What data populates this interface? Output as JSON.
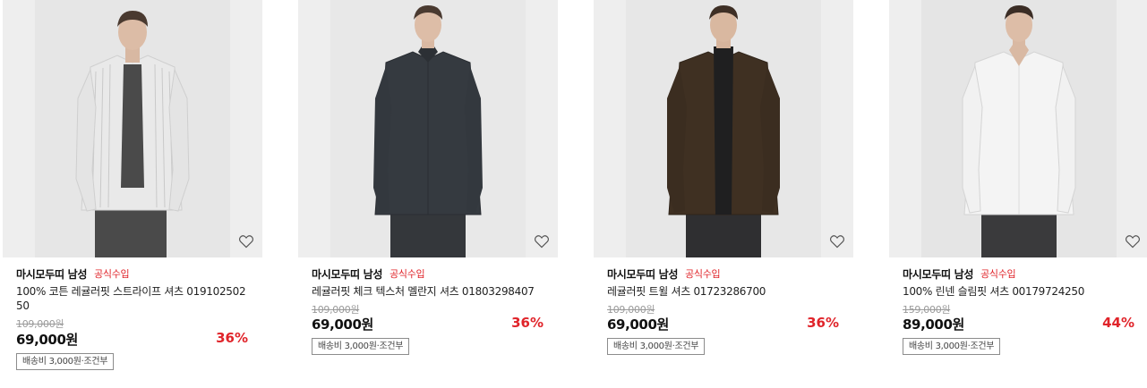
{
  "products": [
    {
      "brand": "마시모두띠 남성",
      "official_badge": "공식수입",
      "title": "100% 코튼 레귤러핏 스트라이프 셔츠 01910250250",
      "original_price": "109,000원",
      "price": "69,000원",
      "discount": "36%",
      "shipping": "배송비 3,000원·조건부",
      "wishlist_icon": "heart-outline-icon",
      "shirt_color": "#e9e9e9"
    },
    {
      "brand": "마시모두띠 남성",
      "official_badge": "공식수입",
      "title": "레귤러핏 체크 텍스처 멜란지 셔츠 01803298407",
      "original_price": "109,000원",
      "price": "69,000원",
      "discount": "36%",
      "shipping": "배송비 3,000원·조건부",
      "wishlist_icon": "heart-outline-icon",
      "shirt_color": "#353a40"
    },
    {
      "brand": "마시모두띠 남성",
      "official_badge": "공식수입",
      "title": "레귤러핏 트윌 셔츠 01723286700",
      "original_price": "109,000원",
      "price": "69,000원",
      "discount": "36%",
      "shipping": "배송비 3,000원·조건부",
      "wishlist_icon": "heart-outline-icon",
      "shirt_color": "#3f3022"
    },
    {
      "brand": "마시모두띠 남성",
      "official_badge": "공식수입",
      "title": "100% 린넨 슬림핏 셔츠 00179724250",
      "original_price": "159,000원",
      "price": "89,000원",
      "discount": "44%",
      "shipping": "배송비 3,000원·조건부",
      "wishlist_icon": "heart-outline-icon",
      "shirt_color": "#f4f4f4"
    }
  ],
  "colors": {
    "accent_red": "#e0242a",
    "photo_background": "#ededed"
  }
}
